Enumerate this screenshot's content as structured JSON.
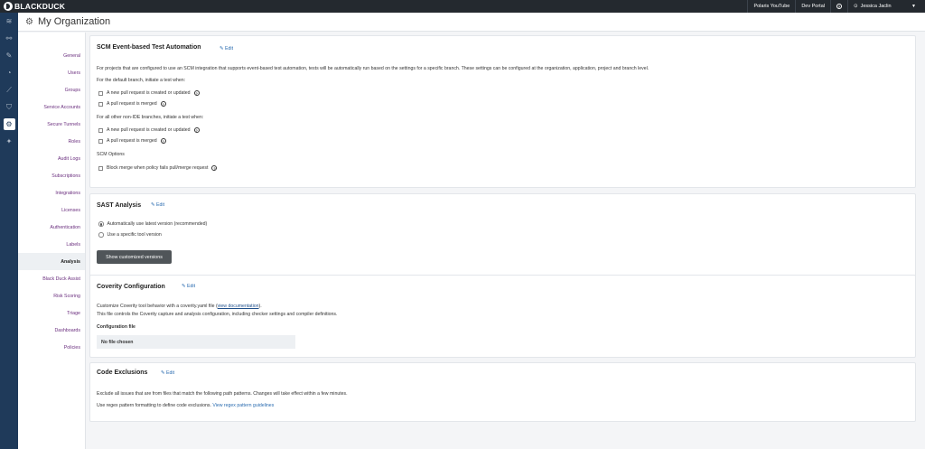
{
  "topbar": {
    "logo": "BLACKDUCK",
    "links": [
      "Polaris YouTube",
      "Dev Portal"
    ],
    "user": "Jessica Jaclin"
  },
  "header": {
    "title": "My Organization"
  },
  "subnav": {
    "items": [
      "General",
      "Users",
      "Groups",
      "Service Accounts",
      "Secure Tunnels",
      "Roles",
      "Audit Logs",
      "Subscriptions",
      "Integrations",
      "Licenses",
      "Authentication",
      "Labels",
      "Analysis",
      "Black Duck Assist",
      "Risk Scoring",
      "Triage",
      "Dashboards",
      "Policies"
    ],
    "active": "Analysis"
  },
  "scm": {
    "title": "SCM Event-based Test Automation",
    "edit": "Edit",
    "intro": "For projects that are configured to use an SCM integration that supports event-based test automation, tests will be automatically run based on the settings for a specific branch. These settings can be configured at the organization, application, project and branch level.",
    "default_label": "For the default branch, initiate a test when:",
    "opt_pr_created": "A new pull request is created or updated",
    "opt_pr_merged": "A pull request is merged",
    "other_label": "For all other non-IDE branches, initiate a test when:",
    "opt2_pr_created": "A new pull request is created or updated",
    "opt2_pr_merged": "A pull request is merged",
    "scm_options": "SCM Options",
    "opt_block": "Block merge when policy fails pull/merge request"
  },
  "sast": {
    "title": "SAST Analysis",
    "edit": "Edit",
    "opt_latest": "Automatically use latest version (recommended)",
    "opt_specific": "Use a specific tool version",
    "button": "Show customized versions"
  },
  "coverity": {
    "title": "Coverity Configuration",
    "edit": "Edit",
    "line1_pre": "Customize Coverity tool behavior with a coverity.yaml file (",
    "line1_link": "view documentation",
    "line1_post": ").",
    "line2": "This file controls the Coverity capture and analysis configuration, including checker settings and compiler definitions.",
    "file_label": "Configuration file",
    "file_value": "No file chosen"
  },
  "exclusions": {
    "title": "Code Exclusions",
    "edit": "Edit",
    "line1": "Exclude all issues that are from files that match the following path patterns. Changes will take effect within a few minutes.",
    "line2_pre": "Use regex pattern formatting to define code exclusions. ",
    "line2_link": "View regex pattern guidelines"
  },
  "icons": {
    "rail": [
      "layers-icon",
      "link-icon",
      "wrench-icon",
      "pie-chart-icon",
      "trend-chart-icon",
      "shield-icon",
      "gear-icon",
      "sparkle-icon"
    ],
    "active_rail": "gear-icon"
  }
}
